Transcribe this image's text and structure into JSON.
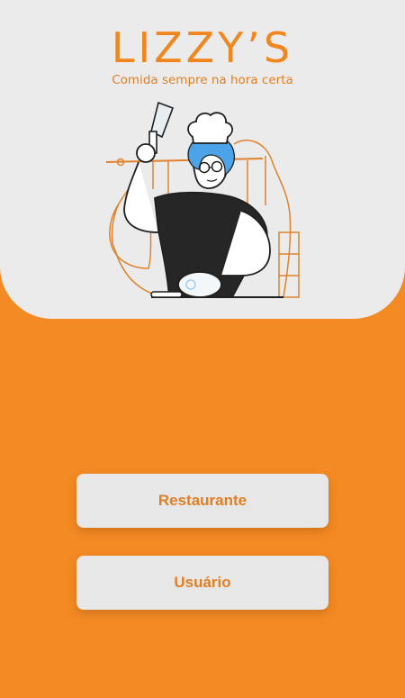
{
  "brand": {
    "name": "LIZZY’S",
    "tagline": "Comida sempre na hora certa"
  },
  "actions": {
    "restaurant_label": "Restaurante",
    "user_label": "Usuário"
  },
  "colors": {
    "primary_orange": "#F48A24",
    "header_background": "#EBEBEB",
    "button_background": "#E7E7E7",
    "button_text": "#E07F24",
    "chef_hair": "#4DA3E8"
  },
  "illustration": {
    "subject": "chef-with-cleaver"
  }
}
